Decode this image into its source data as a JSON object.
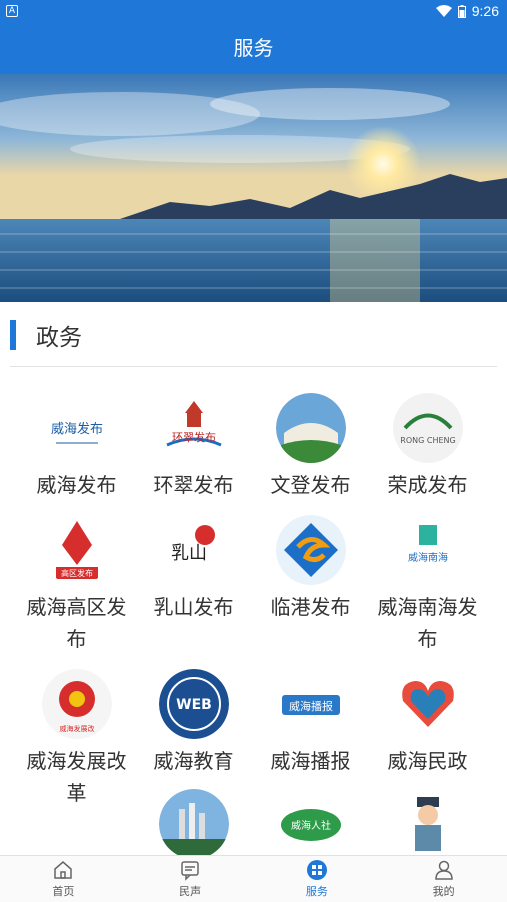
{
  "status_bar": {
    "time": "9:26",
    "app_icon": "A"
  },
  "header": {
    "title": "服务"
  },
  "banner": {
    "description": ""
  },
  "section": {
    "title": "政务"
  },
  "grid": {
    "items": [
      {
        "label": "威海发布",
        "logo_text": "威海发布",
        "icon": "weihai-release-logo"
      },
      {
        "label": "环翠发布",
        "logo_text": "环翠发布",
        "icon": "huancui-release-logo"
      },
      {
        "label": "文登发布",
        "logo_text": "",
        "icon": "wendeng-release-logo"
      },
      {
        "label": "荣成发布",
        "logo_text": "RONG CHENG",
        "icon": "rongcheng-release-logo"
      },
      {
        "label": "威海高区发布",
        "logo_text": "高区发布",
        "icon": "weihai-high-tech-zone-logo"
      },
      {
        "label": "乳山发布",
        "logo_text": "乳山",
        "icon": "rushan-release-logo"
      },
      {
        "label": "临港发布",
        "logo_text": "",
        "icon": "lingang-release-logo"
      },
      {
        "label": "威海南海发布",
        "logo_text": "威海南海",
        "icon": "weihai-nanhai-logo"
      },
      {
        "label": "威海发展改革",
        "logo_text": "威海发展改",
        "icon": "weihai-development-reform-logo"
      },
      {
        "label": "威海教育",
        "logo_text": "WEB",
        "icon": "weihai-education-logo"
      },
      {
        "label": "威海播报",
        "logo_text": "威海播报",
        "icon": "weihai-broadcast-logo"
      },
      {
        "label": "威海民政",
        "logo_text": "",
        "icon": "weihai-civil-affairs-logo"
      },
      {
        "label": "",
        "logo_text": "",
        "icon": "city-view-logo"
      },
      {
        "label": "",
        "logo_text": "威海人社",
        "icon": "weihai-human-resources-logo"
      },
      {
        "label": "",
        "logo_text": "",
        "icon": "traffic-police-logo"
      }
    ]
  },
  "tabbar": {
    "tabs": [
      {
        "label": "首页",
        "icon": "home-icon"
      },
      {
        "label": "民声",
        "icon": "message-icon"
      },
      {
        "label": "服务",
        "icon": "service-icon",
        "active": true
      },
      {
        "label": "我的",
        "icon": "user-icon"
      }
    ]
  },
  "colors": {
    "primary": "#1f78d8"
  }
}
